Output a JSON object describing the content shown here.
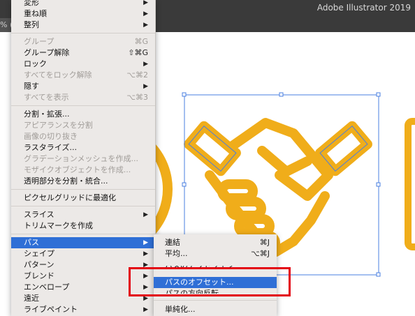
{
  "app": {
    "title": "Adobe Illustrator 2019",
    "doc_tab_fragment": "% (R"
  },
  "menu": {
    "items": [
      {
        "label": "変形",
        "shortcut": "",
        "arrow": true,
        "disabled": false
      },
      {
        "label": "重ね順",
        "shortcut": "",
        "arrow": true,
        "disabled": false
      },
      {
        "label": "整列",
        "shortcut": "",
        "arrow": true,
        "disabled": false
      },
      {
        "label": "グループ",
        "shortcut": "⌘G",
        "arrow": false,
        "disabled": true
      },
      {
        "label": "グループ解除",
        "shortcut": "⇧⌘G",
        "arrow": false,
        "disabled": false
      },
      {
        "label": "ロック",
        "shortcut": "",
        "arrow": true,
        "disabled": false
      },
      {
        "label": "すべてをロック解除",
        "shortcut": "⌥⌘2",
        "arrow": false,
        "disabled": true
      },
      {
        "label": "隠す",
        "shortcut": "",
        "arrow": true,
        "disabled": false
      },
      {
        "label": "すべてを表示",
        "shortcut": "⌥⌘3",
        "arrow": false,
        "disabled": true
      },
      {
        "label": "分割・拡張...",
        "shortcut": "",
        "arrow": false,
        "disabled": false
      },
      {
        "label": "アピアランスを分割",
        "shortcut": "",
        "arrow": false,
        "disabled": true
      },
      {
        "label": "画像の切り抜き",
        "shortcut": "",
        "arrow": false,
        "disabled": true
      },
      {
        "label": "ラスタライズ...",
        "shortcut": "",
        "arrow": false,
        "disabled": false
      },
      {
        "label": "グラデーションメッシュを作成...",
        "shortcut": "",
        "arrow": false,
        "disabled": true
      },
      {
        "label": "モザイクオブジェクトを作成...",
        "shortcut": "",
        "arrow": false,
        "disabled": true
      },
      {
        "label": "透明部分を分割・統合...",
        "shortcut": "",
        "arrow": false,
        "disabled": false
      },
      {
        "label": "ピクセルグリッドに最適化",
        "shortcut": "",
        "arrow": false,
        "disabled": false
      },
      {
        "label": "スライス",
        "shortcut": "",
        "arrow": true,
        "disabled": false
      },
      {
        "label": "トリムマークを作成",
        "shortcut": "",
        "arrow": false,
        "disabled": false
      },
      {
        "label": "パス",
        "shortcut": "",
        "arrow": true,
        "disabled": false,
        "highlighted": true
      },
      {
        "label": "シェイプ",
        "shortcut": "",
        "arrow": true,
        "disabled": false
      },
      {
        "label": "パターン",
        "shortcut": "",
        "arrow": true,
        "disabled": false
      },
      {
        "label": "ブレンド",
        "shortcut": "",
        "arrow": true,
        "disabled": false
      },
      {
        "label": "エンベロープ",
        "shortcut": "",
        "arrow": true,
        "disabled": false
      },
      {
        "label": "遠近",
        "shortcut": "",
        "arrow": true,
        "disabled": false
      },
      {
        "label": "ライブペイント",
        "shortcut": "",
        "arrow": true,
        "disabled": false
      }
    ]
  },
  "submenu": {
    "items": [
      {
        "label": "連結",
        "shortcut": "⌘J"
      },
      {
        "label": "平均...",
        "shortcut": "⌥⌘J"
      },
      {
        "label": "パスのアウトライン",
        "shortcut": ""
      },
      {
        "label": "パスのオフセット...",
        "shortcut": "",
        "highlighted": true
      },
      {
        "label": "パスの方向反転",
        "shortcut": ""
      },
      {
        "label": "単純化...",
        "shortcut": ""
      }
    ]
  },
  "colors": {
    "accent": "#2f6fd6",
    "artwork": "#f0ad1a",
    "selection": "#4a7fe0",
    "callout": "#e3000f"
  }
}
